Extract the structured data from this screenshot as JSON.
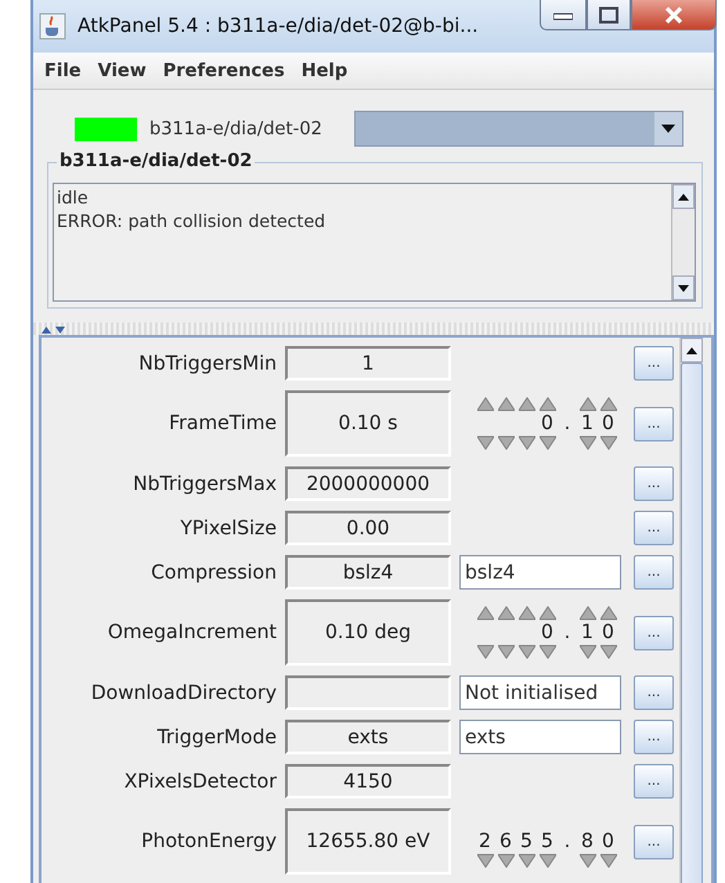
{
  "window": {
    "title": "AtkPanel  5.4  : b311a-e/dia/det-02@b-bi..."
  },
  "menu": [
    "File",
    "View",
    "Preferences",
    "Help"
  ],
  "device": {
    "on": true,
    "name": "b311a-e/dia/det-02"
  },
  "status": {
    "title": "b311a-e/dia/det-02",
    "lines": [
      "idle",
      "ERROR: path collision detected"
    ]
  },
  "attributes": [
    {
      "label": "NbTriggersMin",
      "value": "1",
      "kind": "plain",
      "button": "..."
    },
    {
      "label": "FrameTime",
      "value": "0.10 s",
      "kind": "wheel",
      "wheel": {
        "int_digits": [
          "0"
        ],
        "separator": ".",
        "dec_digits": [
          "1",
          "0"
        ],
        "up_arrows": true
      },
      "button": "..."
    },
    {
      "label": "NbTriggersMax",
      "value": "2000000000",
      "kind": "plain",
      "button": "..."
    },
    {
      "label": "YPixelSize",
      "value": "0.00",
      "kind": "plain",
      "button": "..."
    },
    {
      "label": "Compression",
      "value": "bslz4",
      "kind": "text",
      "setter": "bslz4",
      "button": "..."
    },
    {
      "label": "OmegaIncrement",
      "value": "0.10 deg",
      "kind": "wheel",
      "wheel": {
        "int_digits": [
          "0"
        ],
        "separator": ".",
        "dec_digits": [
          "1",
          "0"
        ],
        "up_arrows": true
      },
      "button": "..."
    },
    {
      "label": "DownloadDirectory",
      "kind": "text",
      "setter": "Not initialised",
      "button": "..."
    },
    {
      "label": "TriggerMode",
      "value": "exts",
      "kind": "text",
      "setter": "exts",
      "button": "..."
    },
    {
      "label": "XPixelsDetector",
      "value": "4150",
      "kind": "plain",
      "button": "..."
    },
    {
      "label": "PhotonEnergy",
      "value": "12655.80 eV",
      "kind": "wheel",
      "wheel": {
        "int_digits": [
          "2",
          "6",
          "5",
          "5"
        ],
        "separator": ".",
        "dec_digits": [
          "8",
          "0"
        ],
        "up_arrows": false
      },
      "button": "..."
    }
  ]
}
